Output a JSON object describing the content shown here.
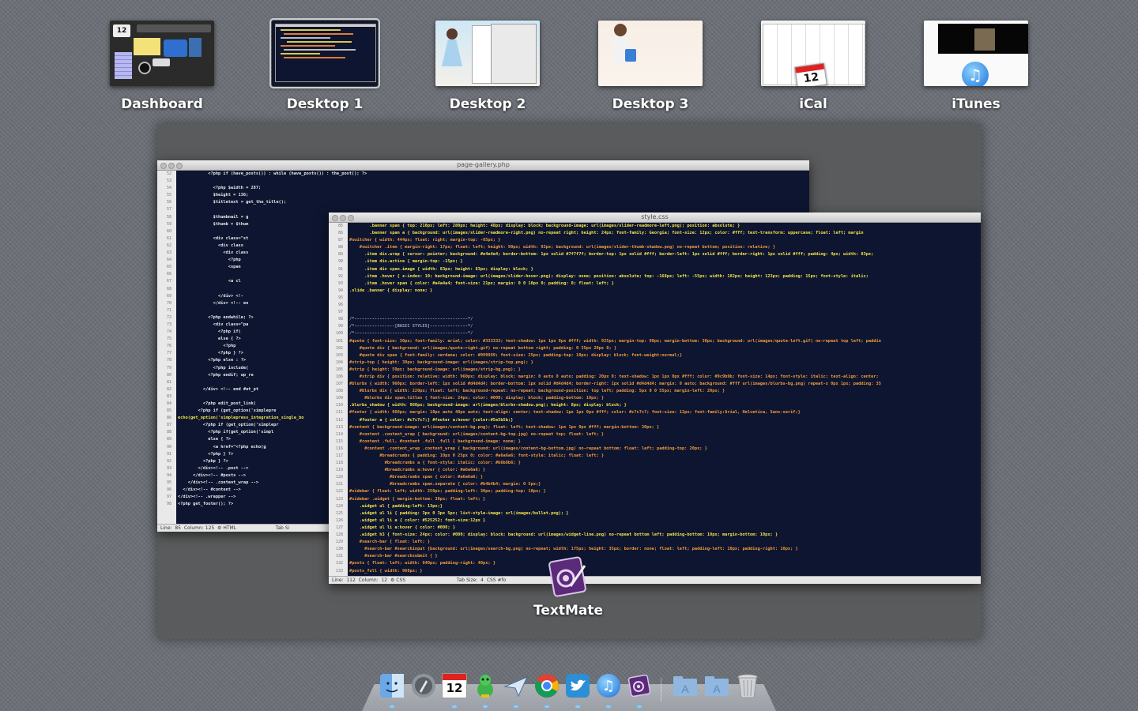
{
  "spaces": [
    {
      "name": "Dashboard",
      "active": false
    },
    {
      "name": "Desktop 1",
      "active": true
    },
    {
      "name": "Desktop 2",
      "active": false
    },
    {
      "name": "Desktop 3",
      "active": false
    },
    {
      "name": "iCal",
      "active": false,
      "badge_day": "12"
    },
    {
      "name": "iTunes",
      "active": false
    }
  ],
  "dashboard_widget": {
    "calendar_day": "12"
  },
  "app_group": {
    "name": "TextMate"
  },
  "window_php": {
    "title": "page-gallery.php",
    "status": {
      "line": "Line:",
      "line_value": "85",
      "column": "Column:",
      "column_value": "125",
      "language": "HTML",
      "tab": "Tab Si"
    },
    "line_numbers": [
      "52",
      "53",
      "54",
      "55",
      "56",
      "57",
      "58",
      "59",
      "60",
      "61",
      "62",
      "63",
      "64",
      "65",
      "66",
      "67",
      "68",
      "69",
      "70",
      "71",
      "72",
      "73",
      "74",
      "75",
      "76",
      "77",
      "78",
      "79",
      "80",
      "81",
      "82",
      "83",
      "84",
      "85",
      "86",
      "87",
      "88",
      "89",
      "90",
      "91",
      "92",
      "93",
      "94",
      "95",
      "96",
      "97",
      "98"
    ],
    "lines": [
      "            <?php if (have_posts()) : while (have_posts()) : the_post(); ?>",
      "",
      "              <?php $width = 287;",
      "              $height = 136;",
      "              $titletext = get_the_title();",
      "",
      "              $thumbnail = g",
      "              $thumb = $thum",
      "",
      "              <div class=\"st",
      "                <div class",
      "                  <div class",
      "                    <?php",
      "                    <span",
      "",
      "                    <a cl",
      "",
      "                </div> <!-",
      "              </div> <!-- en",
      "",
      "            <?php endwhile; ?>",
      "              <div class=\"pa",
      "                <?php if(",
      "                else { ?>",
      "                  <?php",
      "                <?php } ?>",
      "            <?php else : ?>",
      "              <?php include(",
      "            <?php endif; wp_re",
      "",
      "          </div> <!-- end #et_pt",
      "",
      "          <?php edit_post_link(",
      "        <?php if (get_option('simplepre",
      "echo(get_option('simplepress_integration_single_bo",
      "          <?php if (get_option('simplepr",
      "            <?php if(get_option('simpl",
      "            else { ?>",
      "              <a href=\"<?php echo(g",
      "            <?php } ?>",
      "          <?php } ?>",
      "        </div><!-- .post -->",
      "      </div><!-- #posts -->",
      "    </div><!-- .content_wrap -->",
      "  </div><!-- #content -->",
      "</div><!-- .wrapper -->",
      "<?php get_footer(); ?>"
    ]
  },
  "window_css": {
    "title": "style.css",
    "status": {
      "line": "Line:",
      "line_value": "112",
      "column": "Column:",
      "column_value": "12",
      "language": "CSS",
      "tab": "Tab Size:",
      "tab_value": "4",
      "scope": "CSS #fo"
    },
    "line_numbers": [
      "85",
      "86",
      "87",
      "88",
      "89",
      "90",
      "91",
      "92",
      "93",
      "94",
      "95",
      "96",
      "97",
      "98",
      "99",
      "100",
      "101",
      "102",
      "103",
      "104",
      "105",
      "106",
      "107",
      "108",
      "109",
      "110",
      "111",
      "112",
      "113",
      "114",
      "115",
      "116",
      "117",
      "118",
      "119",
      "120",
      "121",
      "122",
      "123",
      "124",
      "125",
      "126",
      "127",
      "128",
      "129",
      "130",
      "131",
      "132",
      "133"
    ],
    "lines": [
      "        .banner span { top: 210px; left: 280px; height: 48px; display: block; background-image: url(images/slider-readmore-left.png); position: absolute; }",
      "        .banner span a { background: url(images/slider-readmore-right.png) no-repeat right; height: 24px; font-family: Georgia; font-size: 12px; color: #fff; text-transform: uppercase; float: left; margin",
      "#switcher { width: 444px; float: right; margin-top: -85px; }",
      "    #switcher .item { margin-right: 17px; float: left; height: 90px; width: 93px; background: url(images/slider-thumb-shadow.png) no-repeat bottom; position: relative; }",
      "      .item div.wrap { cursor: pointer; background: #e4e4e4; border-bottom: 1px solid #7f7f7f; border-top: 1px solid #fff; border-left: 1px solid #fff; border-right: 1px solid #fff; padding: 4px; width: 83px;",
      "      .item div.active { margin-top: -15px; }",
      "      .item div span.image { width: 83px; height: 83px; display: block; }",
      "      .item .hover { z-index: 10; background-image: url(images/slider-hover.png); display: none; position: absolute; top: -168px; left: -55px; width: 182px; height: 123px; padding: 15px; font-style: italic;",
      "      .item .hover span { color: #a4a4a4; font-size: 21px; margin: 0 0 10px 0; padding: 0; float: left; }",
      ".slide .banner { display: none; }",
      "",
      "",
      "",
      "/*---------------------------------------------*/",
      "/*----------------[BASIC STYLES]---------------*/",
      "/*---------------------------------------------*/",
      "#quote { font-size: 30px; font-family: arial; color: #333333; text-shadow: 1px 1px 0px #fff; width: 925px; margin-top: 90px; margin-bottom: 30px; background: url(images/quote-left.gif) no-repeat top left; paddin",
      "    #quote div { background: url(images/quote-right.gif) no-repeat bottom right; padding: 0 35px 20px 0; }",
      "    #quote div span { font-family: verdana; color: #999999; font-size: 25px; padding-top: 10px; display: block; font-weight:normal;}",
      "#strip-top { height: 39px; background-image: url(images/strip-top.png); }",
      "#strip { height: 59px; background-image: url(images/strip-bg.png); }",
      "    #strip div { position: relative; width: 960px; display: block; margin: 0 auto 0 auto; padding: 20px 0; text-shadow: 1px 1px 0px #fff; color: #9c9b9b; font-size: 14px; font-style: italic; text-align: center;",
      "#blurbs { width: 960px; border-left: 1px solid #d4d4d4; border-bottom: 1px solid #d4d4d4; border-right: 1px solid #d4d4d4; margin: 0 auto; background: #fff url(images/blurbs-bg.png) repeat-x 0px 1px; padding: 35",
      "    #blurbs div { width: 220px; float: left; background-repeat: no-repeat; background-position: top left; padding: 5px 0 0 55px; margin-left: 20px; }",
      "      #blurbs div span.titles { font-size: 24px; color: #000; display: block; padding-bottom: 10px; }",
      ".blurbs_shadow { width: 960px; background-image: url(images/blurbs-shadow.png); height: 8px; display: block; }",
      "#footer { width: 960px; margin: 10px auto 40px auto; text-align: center; text-shadow: 1px 1px 0px #fff; color: #c7c7c7; font-size: 12px; font-family:Arial, Helvetica, Sans-serif;}",
      "    #footer a { color: #c7c7c7;} #footer a:hover {color:#5e5b5b;}",
      "#content { background-image: url(images/content-bg.png); float: left; text-shadow: 1px 1px 0px #fff; margin-bottom: 30px; }",
      "    #content .content_wrap { background: url(images/content-bg-top.jpg) no-repeat top; float: left; }",
      "    #content .full, #content .full .full { background-image: none; }",
      "      #content .content_wrap .content_wrap { background: url(images/content-bg-bottom.jpg) no-repeat bottom; float: left; padding-top: 20px; }",
      "            #breadcrumbs { padding: 10px 0 25px 0; color: #a6a6a6; font-style: italic; float: left; }",
      "              #breadcrumbs a { font-style: italic; color: #b6b6b6; }",
      "              #breadcrumbs a:hover { color: #a6a6a6; }",
      "                #breadcrumbs span { color: #a6a6a6; }",
      "                #breadcrumbs span.separate { color: #b4b4b4; margin: 0 5px;}",
      "#sidebar { float: left; width: 250px; padding-left: 30px; padding-top: 10px; }",
      "#sidebar .widget { margin-bottom: 30px; float: left; }",
      "    .widget ul { padding-left: 13px;}",
      "    .widget ul li { padding: 3px 0 3px 5px; list-style-image: url(images/bullet.png); }",
      "    .widget ul li a { color: #525252; font-size:12px }",
      "    .widget ul li a:hover { color: #000; }",
      "    .widget h3 { font-size: 24px; color: #000; display: block; background: url(images/widget-line.png) no-repeat bottom left; padding-bottom: 10px; margin-bottom: 10px; }",
      "    #search-bar { float: left; }",
      "      #search-bar #searchinput {background: url(images/search-bg.png) no-repeat; width: 175px; height: 35px; border: none; float: left; padding-left: 10px; padding-right: 10px; }",
      "      #search-bar #searchsubmit { }",
      "#posts { float: left; width: 640px; padding-right: 40px; }",
      "#posts_full { width: 960px; }"
    ]
  },
  "dock": [
    {
      "name": "Finder"
    },
    {
      "name": "Launchpad"
    },
    {
      "name": "iCal",
      "badge_day": "12"
    },
    {
      "name": "Adium"
    },
    {
      "name": "Sparrow"
    },
    {
      "name": "Google Chrome"
    },
    {
      "name": "Twitter"
    },
    {
      "name": "iTunes"
    },
    {
      "name": "TextMate"
    },
    {
      "name": "Applications"
    },
    {
      "name": "Documents"
    },
    {
      "name": "Trash"
    }
  ],
  "colors": {
    "editor_bg": "#0d1530",
    "code_yellow": "#f2e24a",
    "code_orange": "#f29b3a",
    "code_white": "#e8e8e8",
    "code_gray": "#9aa3b8",
    "active_outline": "#c9ccd1"
  }
}
